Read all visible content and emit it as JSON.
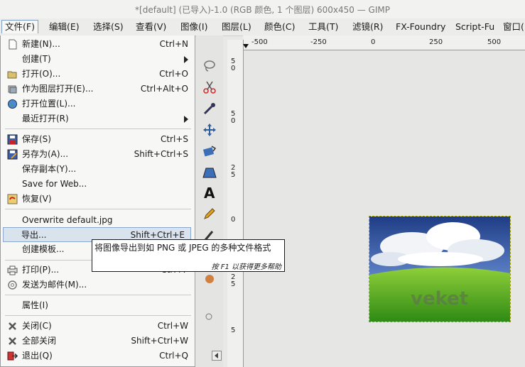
{
  "window": {
    "title": "*[default] (已导入)-1.0 (RGB 颜色, 1 个图层) 600x450 — GIMP"
  },
  "menubar": [
    "文件(F)",
    "编辑(E)",
    "选择(S)",
    "查看(V)",
    "图像(I)",
    "图层(L)",
    "颜色(C)",
    "工具(T)",
    "滤镜(R)",
    "FX-Foundry",
    "Script-Fu",
    "窗口("
  ],
  "file_menu": {
    "new": {
      "label": "新建(N)...",
      "shortcut": "Ctrl+N"
    },
    "create": {
      "label": "创建(T)"
    },
    "open": {
      "label": "打开(O)...",
      "shortcut": "Ctrl+O"
    },
    "open_as_layers": {
      "label": "作为图层打开(E)...",
      "shortcut": "Ctrl+Alt+O"
    },
    "open_location": {
      "label": "打开位置(L)..."
    },
    "open_recent": {
      "label": "最近打开(R)"
    },
    "save": {
      "label": "保存(S)",
      "shortcut": "Ctrl+S"
    },
    "save_as": {
      "label": "另存为(A)...",
      "shortcut": "Shift+Ctrl+S"
    },
    "save_copy": {
      "label": "保存副本(Y)..."
    },
    "save_for_web": {
      "label": "Save for Web..."
    },
    "revert": {
      "label": "恢复(V)"
    },
    "overwrite": {
      "label": "Overwrite default.jpg"
    },
    "export": {
      "label": "导出...",
      "shortcut": "Shift+Ctrl+E"
    },
    "create_template": {
      "label": "创建模板..."
    },
    "print": {
      "label": "打印(P)...",
      "shortcut": "Ctrl+P"
    },
    "send_mail": {
      "label": "发送为邮件(M)..."
    },
    "properties": {
      "label": "属性(I)"
    },
    "close": {
      "label": "关闭(C)",
      "shortcut": "Ctrl+W"
    },
    "close_all": {
      "label": "全部关闭",
      "shortcut": "Shift+Ctrl+W"
    },
    "quit": {
      "label": "退出(Q)",
      "shortcut": "Ctrl+Q"
    }
  },
  "tooltip": {
    "text": "将图像导出到如 PNG 或 JPEG 的多种文件格式",
    "help": "按 F1 以获得更多帮助"
  },
  "ruler": {
    "h_ticks": [
      "-500",
      "-250",
      "0",
      "250",
      "500"
    ],
    "v_ticks": [
      "5\n0",
      "5\n0",
      "2\n5",
      "0",
      "2\n5",
      "5"
    ]
  },
  "image": {
    "watermark": "veket"
  },
  "colors": {
    "highlight": "#d9e3ee",
    "highlight_border": "#8ba8cc",
    "menu_bg": "#f7f7f5"
  }
}
